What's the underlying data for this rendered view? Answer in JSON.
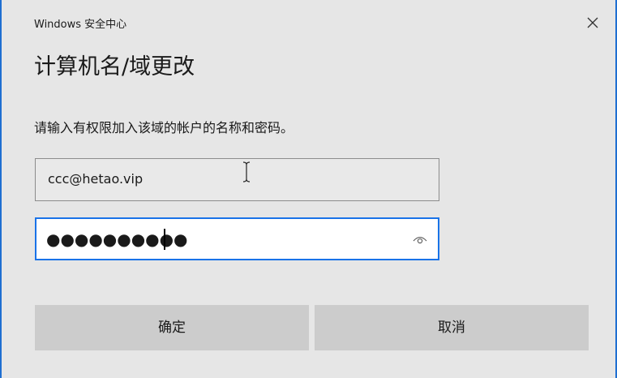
{
  "window": {
    "app_title": "Windows 安全中心"
  },
  "dialog": {
    "heading": "计算机名/域更改",
    "prompt": "请输入有权限加入该域的帐户的名称和密码。"
  },
  "username_field": {
    "value": "ccc@hetao.vip"
  },
  "password_field": {
    "masked_value": "●●●●●●●●●●"
  },
  "buttons": {
    "ok_label": "确定",
    "cancel_label": "取消"
  },
  "icons": {
    "close": "close-icon",
    "reveal": "eye-icon"
  },
  "colors": {
    "accent": "#1a73e8",
    "button_bg": "#cccccc",
    "dialog_bg": "#e6e6e6"
  }
}
